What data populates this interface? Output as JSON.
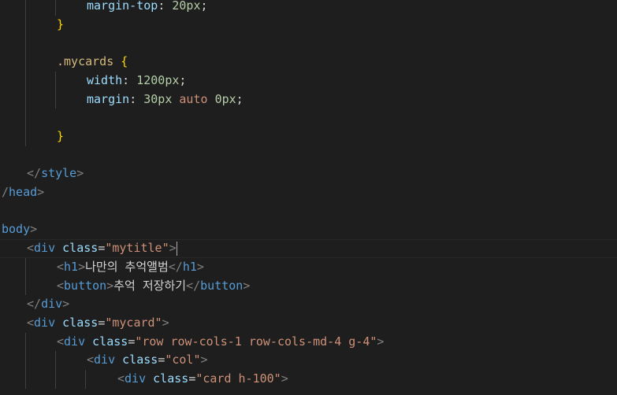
{
  "editor": {
    "lines": [
      {
        "indent": 108,
        "tokens": [
          {
            "t": "margin-top",
            "c": "prop"
          },
          {
            "t": ": ",
            "c": "punc"
          },
          {
            "t": "20px",
            "c": "num"
          },
          {
            "t": ";",
            "c": "punc"
          }
        ]
      },
      {
        "indent": 70,
        "tokens": [
          {
            "t": "}",
            "c": "br1"
          }
        ]
      },
      {
        "indent": 0,
        "tokens": []
      },
      {
        "indent": 70,
        "tokens": [
          {
            "t": ".mycards",
            "c": "sel"
          },
          {
            "t": " ",
            "c": "punc"
          },
          {
            "t": "{",
            "c": "br1"
          }
        ]
      },
      {
        "indent": 108,
        "tokens": [
          {
            "t": "width",
            "c": "prop"
          },
          {
            "t": ": ",
            "c": "punc"
          },
          {
            "t": "1200px",
            "c": "num"
          },
          {
            "t": ";",
            "c": "punc"
          }
        ]
      },
      {
        "indent": 108,
        "tokens": [
          {
            "t": "margin",
            "c": "prop"
          },
          {
            "t": ": ",
            "c": "punc"
          },
          {
            "t": "30px",
            "c": "num"
          },
          {
            "t": " ",
            "c": "punc"
          },
          {
            "t": "auto",
            "c": "kw"
          },
          {
            "t": " ",
            "c": "punc"
          },
          {
            "t": "0px",
            "c": "num"
          },
          {
            "t": ";",
            "c": "punc"
          }
        ]
      },
      {
        "indent": 0,
        "tokens": []
      },
      {
        "indent": 70,
        "tokens": [
          {
            "t": "}",
            "c": "br1"
          }
        ]
      },
      {
        "indent": 0,
        "tokens": []
      },
      {
        "indent": 32,
        "tokens": [
          {
            "t": "</",
            "c": "ang"
          },
          {
            "t": "style",
            "c": "tag"
          },
          {
            "t": ">",
            "c": "ang"
          }
        ]
      },
      {
        "indent": 0,
        "tokens": [
          {
            "t": "/",
            "c": "ang"
          },
          {
            "t": "head",
            "c": "tag"
          },
          {
            "t": ">",
            "c": "ang"
          }
        ]
      },
      {
        "indent": 0,
        "tokens": []
      },
      {
        "indent": 0,
        "tokens": [
          {
            "t": "body",
            "c": "tag"
          },
          {
            "t": ">",
            "c": "ang"
          }
        ]
      },
      {
        "indent": 32,
        "current": true,
        "tokens": [
          {
            "t": "<",
            "c": "ang"
          },
          {
            "t": "div",
            "c": "tag"
          },
          {
            "t": " ",
            "c": "punc"
          },
          {
            "t": "class",
            "c": "attr"
          },
          {
            "t": "=",
            "c": "punc"
          },
          {
            "t": "\"mytitle\"",
            "c": "str"
          },
          {
            "t": ">",
            "c": "ang"
          }
        ]
      },
      {
        "indent": 70,
        "tokens": [
          {
            "t": "<",
            "c": "ang"
          },
          {
            "t": "h1",
            "c": "tag"
          },
          {
            "t": ">",
            "c": "ang"
          },
          {
            "t": "나만의 추억앨범",
            "c": "text"
          },
          {
            "t": "</",
            "c": "ang"
          },
          {
            "t": "h1",
            "c": "tag"
          },
          {
            "t": ">",
            "c": "ang"
          }
        ]
      },
      {
        "indent": 70,
        "tokens": [
          {
            "t": "<",
            "c": "ang"
          },
          {
            "t": "button",
            "c": "tag"
          },
          {
            "t": ">",
            "c": "ang"
          },
          {
            "t": "추억 저장하기",
            "c": "text"
          },
          {
            "t": "</",
            "c": "ang"
          },
          {
            "t": "button",
            "c": "tag"
          },
          {
            "t": ">",
            "c": "ang"
          }
        ]
      },
      {
        "indent": 32,
        "tokens": [
          {
            "t": "</",
            "c": "ang"
          },
          {
            "t": "div",
            "c": "tag"
          },
          {
            "t": ">",
            "c": "ang"
          }
        ]
      },
      {
        "indent": 32,
        "tokens": [
          {
            "t": "<",
            "c": "ang"
          },
          {
            "t": "div",
            "c": "tag"
          },
          {
            "t": " ",
            "c": "punc"
          },
          {
            "t": "class",
            "c": "attr"
          },
          {
            "t": "=",
            "c": "punc"
          },
          {
            "t": "\"mycard\"",
            "c": "str"
          },
          {
            "t": ">",
            "c": "ang"
          }
        ]
      },
      {
        "indent": 70,
        "tokens": [
          {
            "t": "<",
            "c": "ang"
          },
          {
            "t": "div",
            "c": "tag"
          },
          {
            "t": " ",
            "c": "punc"
          },
          {
            "t": "class",
            "c": "attr"
          },
          {
            "t": "=",
            "c": "punc"
          },
          {
            "t": "\"row row-cols-1 row-cols-md-4 g-4\"",
            "c": "str"
          },
          {
            "t": ">",
            "c": "ang"
          }
        ]
      },
      {
        "indent": 108,
        "tokens": [
          {
            "t": "<",
            "c": "ang"
          },
          {
            "t": "div",
            "c": "tag"
          },
          {
            "t": " ",
            "c": "punc"
          },
          {
            "t": "class",
            "c": "attr"
          },
          {
            "t": "=",
            "c": "punc"
          },
          {
            "t": "\"col\"",
            "c": "str"
          },
          {
            "t": ">",
            "c": "ang"
          }
        ]
      },
      {
        "indent": 147,
        "tokens": [
          {
            "t": "<",
            "c": "ang"
          },
          {
            "t": "div",
            "c": "tag"
          },
          {
            "t": " ",
            "c": "punc"
          },
          {
            "t": "class",
            "c": "attr"
          },
          {
            "t": "=",
            "c": "punc"
          },
          {
            "t": "\"card h-100\"",
            "c": "str"
          },
          {
            "t": ">",
            "c": "ang"
          }
        ]
      }
    ]
  }
}
